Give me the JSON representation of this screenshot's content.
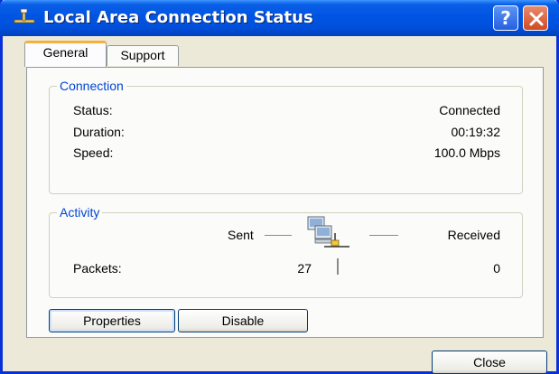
{
  "window": {
    "title": "Local Area Connection Status",
    "title_icon": "network-connection-icon",
    "help_label": "?",
    "close_glyph": "close-icon",
    "titlebar_color": "#0054e3"
  },
  "tabs": [
    {
      "label": "General",
      "selected": true
    },
    {
      "label": "Support",
      "selected": false
    }
  ],
  "connection": {
    "legend": "Connection",
    "rows": [
      {
        "label": "Status:",
        "value": "Connected"
      },
      {
        "label": "Duration:",
        "value": "00:19:32"
      },
      {
        "label": "Speed:",
        "value": "100.0 Mbps"
      }
    ]
  },
  "activity": {
    "legend": "Activity",
    "sent_label": "Sent",
    "received_label": "Received",
    "packets_label": "Packets:",
    "packets_sent": "27",
    "packets_received": "0",
    "icon": "network-computers-icon"
  },
  "buttons": {
    "properties": "Properties",
    "disable": "Disable",
    "close": "Close"
  },
  "colors": {
    "legend": "#0046d5",
    "dialog_bg": "#ece9d8",
    "tab_highlight": "#f6b13b"
  }
}
